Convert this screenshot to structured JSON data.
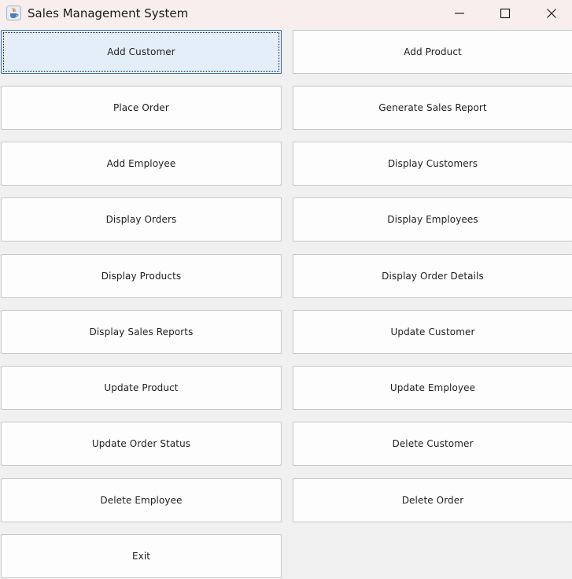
{
  "window": {
    "title": "Sales Management System"
  },
  "colors": {
    "titlebar_bg": "#f8eeee",
    "window_bg": "#f0f0f0",
    "focused_button_bg": "#e3eef9",
    "button_bg": "#fdfdfd"
  },
  "icons": {
    "app": "java-coffee-cup-icon",
    "minimize": "minimize-icon",
    "maximize": "maximize-icon",
    "close": "close-icon"
  },
  "buttons": {
    "add_customer": "Add Customer",
    "add_product": "Add Product",
    "place_order": "Place Order",
    "generate_sales_report": "Generate Sales Report",
    "add_employee": "Add Employee",
    "display_customers": "Display Customers",
    "display_orders": "Display Orders",
    "display_employees": "Display Employees",
    "display_products": "Display Products",
    "display_order_details": "Display Order Details",
    "display_sales_reports": "Display Sales Reports",
    "update_customer": "Update Customer",
    "update_product": "Update Product",
    "update_employee": "Update Employee",
    "update_order_status": "Update Order Status",
    "delete_customer": "Delete Customer",
    "delete_employee": "Delete Employee",
    "delete_order": "Delete Order",
    "exit": "Exit"
  }
}
